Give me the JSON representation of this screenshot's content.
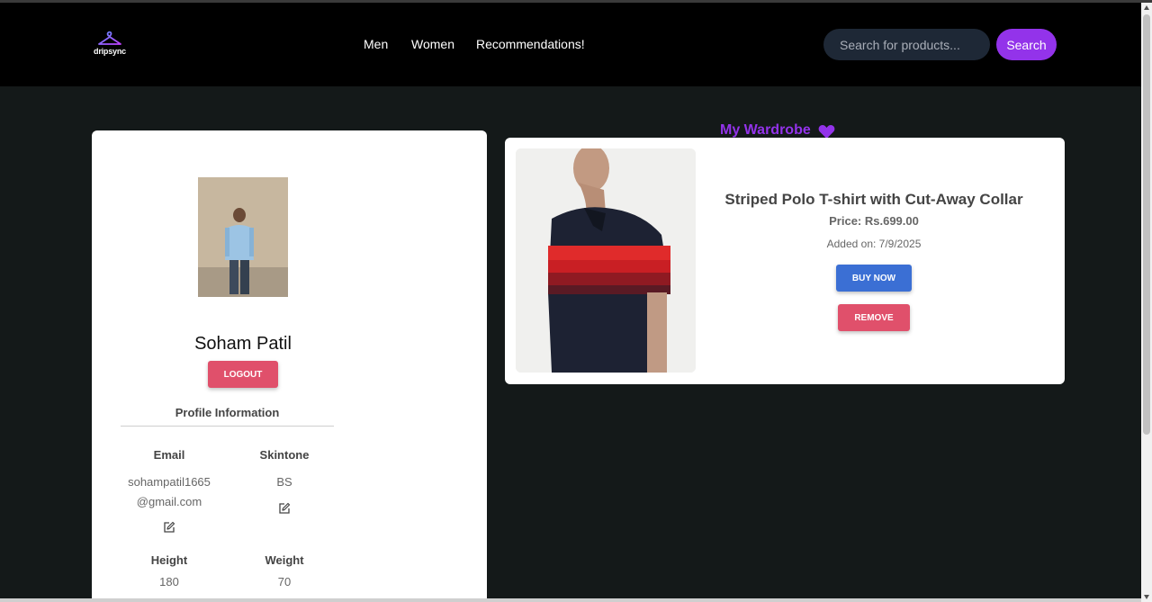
{
  "brand": {
    "logo_text": "dripsync",
    "accent": "#9333ea"
  },
  "nav": {
    "links": [
      {
        "label": "Men"
      },
      {
        "label": "Women"
      },
      {
        "label": "Recommendations!"
      }
    ],
    "search_placeholder": "Search for products...",
    "search_button": "Search"
  },
  "profile": {
    "name": "Soham Patil",
    "logout_label": "LOGOUT",
    "section_title": "Profile Information",
    "fields": {
      "email": {
        "label": "Email",
        "value_line1": "sohampatil1665",
        "value_line2": "@gmail.com"
      },
      "skintone": {
        "label": "Skintone",
        "value": "BS"
      },
      "height": {
        "label": "Height",
        "value": "180"
      },
      "weight": {
        "label": "Weight",
        "value": "70"
      }
    }
  },
  "wardrobe": {
    "title": "My Wardrobe",
    "items": [
      {
        "title": "Striped Polo T-shirt with Cut-Away Collar",
        "price": "Price: Rs.699.00",
        "added": "Added on: 7/9/2025",
        "buy_label": "BUY NOW",
        "remove_label": "REMOVE"
      }
    ]
  },
  "icons": {
    "logo": "hanger-icon",
    "edit": "edit-icon",
    "heart": "heart-icon"
  }
}
